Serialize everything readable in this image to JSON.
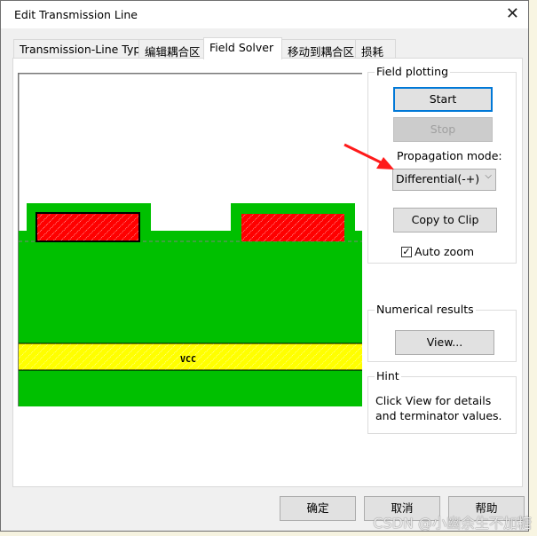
{
  "window": {
    "title": "Edit Transmission Line",
    "close_icon": "close-icon"
  },
  "tabs": [
    {
      "label": "Transmission-Line Type",
      "active": false
    },
    {
      "label": "编辑耦合区",
      "active": false
    },
    {
      "label": "Field Solver",
      "active": true
    },
    {
      "label": "移动到耦合区",
      "active": false
    },
    {
      "label": "损耗",
      "active": false
    }
  ],
  "cross_section": {
    "layer_label": "VCC",
    "colors": {
      "dielectric": "#00c000",
      "trace": "#ff0000",
      "plane": "#ffff00",
      "background": "#ffffff"
    },
    "selected_trace": "left"
  },
  "field_plotting": {
    "label": "Field plotting",
    "start_label": "Start",
    "stop_label": "Stop",
    "propagation_label": "Propagation mode:",
    "propagation_value": "Differential(-+)",
    "copy_label": "Copy to Clip",
    "auto_zoom_label": "Auto zoom",
    "auto_zoom_checked": true
  },
  "numerical_results": {
    "label": "Numerical results",
    "view_label": "View..."
  },
  "hint": {
    "label": "Hint",
    "text": "Click View for details and terminator values."
  },
  "footer": {
    "ok_label": "确定",
    "cancel_label": "取消",
    "help_label": "帮助"
  },
  "watermark": "CSDN @小幽余生不加糖"
}
